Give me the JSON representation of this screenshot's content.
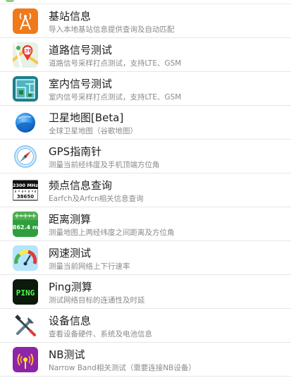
{
  "menu": {
    "items": [
      {
        "title": "基站信息",
        "subtitle": "导入本地基站信息提供查询及自动匹配",
        "icon": "cell-tower-icon"
      },
      {
        "title": "道路信号测试",
        "subtitle": "道路信号采样打点测试，支持LTE、GSM",
        "icon": "road-test-map-icon"
      },
      {
        "title": "室内信号测试",
        "subtitle": "室内信号采样打点测试，支持LTE、GSM",
        "icon": "indoor-floorplan-icon"
      },
      {
        "title": "卫星地图[Beta]",
        "subtitle": "全球卫星地图（谷歌地图）",
        "icon": "satellite-map-icon"
      },
      {
        "title": "GPS指南针",
        "subtitle": "测量当前经纬度及手机顶端方位角",
        "icon": "compass-icon"
      },
      {
        "title": "频点信息查询",
        "subtitle": "Earfch及Arfcn相关信息查询",
        "icon": "frequency-display-icon",
        "icon_text_top": "2300 MHz",
        "icon_text_bottom": "38650"
      },
      {
        "title": "距离测算",
        "subtitle": "测量地图上两经纬度之间距离及方位角",
        "icon": "distance-measure-icon",
        "icon_text": "862.4 m"
      },
      {
        "title": "网速测试",
        "subtitle": "测量当前网络上下行速率",
        "icon": "speedometer-icon"
      },
      {
        "title": "Ping测算",
        "subtitle": "测试网络目标的连通性及时延",
        "icon": "ping-icon",
        "icon_text": "PING"
      },
      {
        "title": "设备信息",
        "subtitle": "查看设备硬件、系统及电池信息",
        "icon": "tools-icon"
      },
      {
        "title": "NB测试",
        "subtitle": "Narrow Band相关测试（需要连接NB设备）",
        "icon": "nb-signal-icon"
      }
    ]
  }
}
